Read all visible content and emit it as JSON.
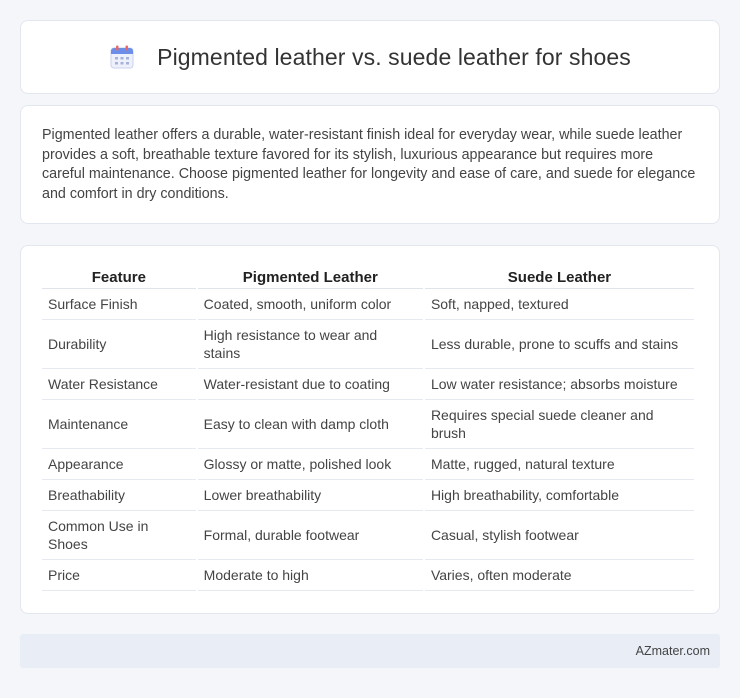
{
  "header": {
    "title": "Pigmented leather vs. suede leather for shoes",
    "icon": "calendar-icon"
  },
  "summary": {
    "text": "Pigmented leather offers a durable, water-resistant finish ideal for everyday wear, while suede leather provides a soft, breathable texture favored for its stylish, luxurious appearance but requires more careful maintenance. Choose pigmented leather for longevity and ease of care, and suede for elegance and comfort in dry conditions."
  },
  "table": {
    "headers": [
      "Feature",
      "Pigmented Leather",
      "Suede Leather"
    ],
    "rows": [
      [
        "Surface Finish",
        "Coated, smooth, uniform color",
        "Soft, napped, textured"
      ],
      [
        "Durability",
        "High resistance to wear and stains",
        "Less durable, prone to scuffs and stains"
      ],
      [
        "Water Resistance",
        "Water-resistant due to coating",
        "Low water resistance; absorbs moisture"
      ],
      [
        "Maintenance",
        "Easy to clean with damp cloth",
        "Requires special suede cleaner and brush"
      ],
      [
        "Appearance",
        "Glossy or matte, polished look",
        "Matte, rugged, natural texture"
      ],
      [
        "Breathability",
        "Lower breathability",
        "High breathability, comfortable"
      ],
      [
        "Common Use in Shoes",
        "Formal, durable footwear",
        "Casual, stylish footwear"
      ],
      [
        "Price",
        "Moderate to high",
        "Varies, often moderate"
      ]
    ]
  },
  "footer": {
    "brand": "AZmater.com"
  },
  "colors": {
    "background": "#f4f6fa",
    "card": "#ffffff",
    "footer": "#e8edf6",
    "icon_accent": "#5b7be0"
  }
}
